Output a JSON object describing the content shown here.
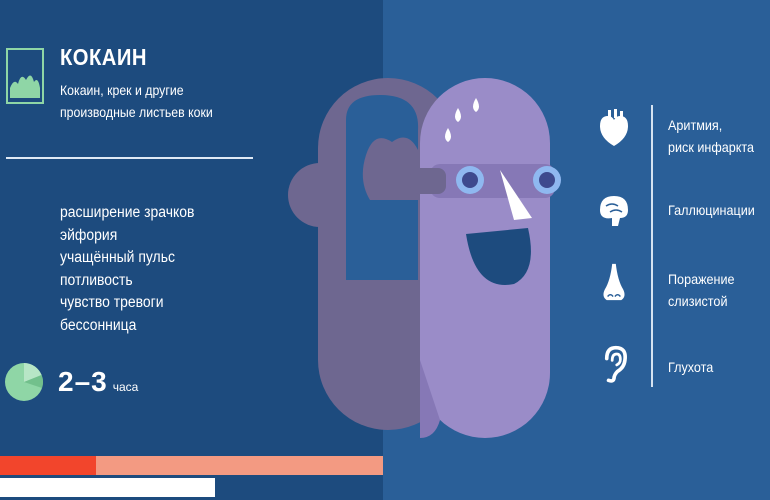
{
  "title": "КОКАИН",
  "subtitle": [
    "Кокаин, крек и другие",
    "производные листьев коки"
  ],
  "effects": [
    "расширение зрачков",
    "эйфория",
    "учащённый пульс",
    "потливость",
    "чувство тревоги",
    "бессонница"
  ],
  "duration": {
    "value": "2–3",
    "unit": "часа"
  },
  "consequences": [
    {
      "icon": "heart-icon",
      "lines": [
        "Аритмия,",
        "риск инфаркта"
      ]
    },
    {
      "icon": "brain-icon",
      "lines": [
        "Галлюцинации"
      ]
    },
    {
      "icon": "nose-icon",
      "lines": [
        "Поражение",
        "слизистой"
      ]
    },
    {
      "icon": "ear-icon",
      "lines": [
        "Глухота"
      ]
    }
  ],
  "colors": {
    "left_panel": "#1d4b7e",
    "right_panel": "#2a5f98",
    "accent_green": "#8fd6a6",
    "bar_red": "#f2452c",
    "bar_peach": "#f39a82",
    "face_front": "#9a8cc8",
    "face_back": "#6e6790"
  }
}
